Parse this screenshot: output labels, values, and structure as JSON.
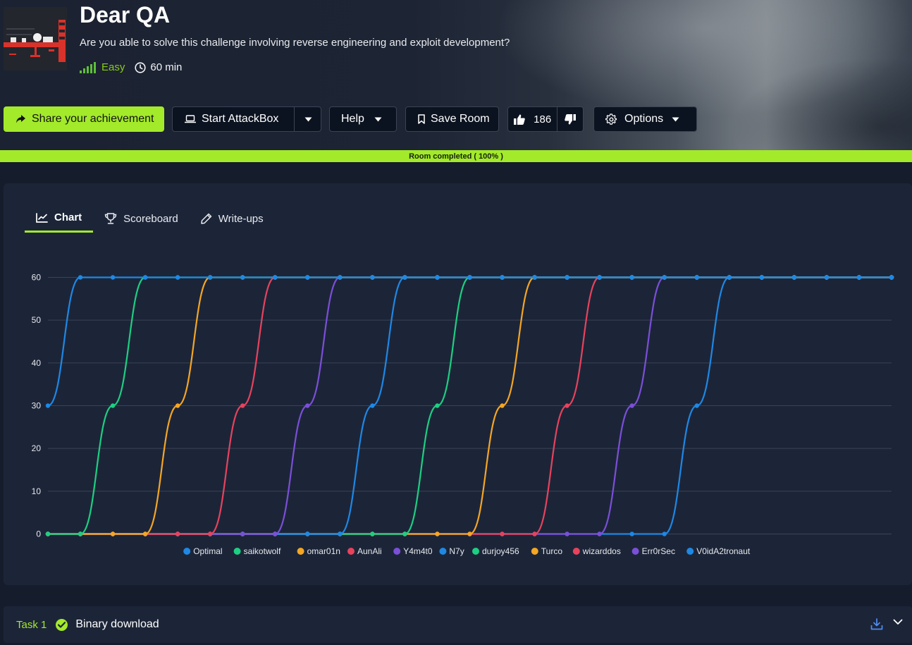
{
  "room": {
    "title": "Dear QA",
    "description": "Are you able to solve this challenge involving reverse engineering and exploit development?",
    "difficulty": "Easy",
    "duration": "60 min",
    "icon": "room-thumbnail"
  },
  "actions": {
    "share_label": "Share your achievement",
    "attackbox_label": "Start AttackBox",
    "help_label": "Help",
    "save_label": "Save Room",
    "upvotes": "186",
    "options_label": "Options"
  },
  "progress": {
    "label": "Room completed ( 100% )",
    "value": 1.0
  },
  "tabs": [
    {
      "label": "Chart",
      "active": true,
      "icon": "chart-line-icon"
    },
    {
      "label": "Scoreboard",
      "active": false,
      "icon": "trophy-icon"
    },
    {
      "label": "Write-ups",
      "active": false,
      "icon": "pencil-icon"
    }
  ],
  "chart_data": {
    "type": "line",
    "x": [
      0,
      1,
      2,
      3,
      4,
      5,
      6,
      7,
      8,
      9,
      10,
      11,
      12,
      13,
      14,
      15,
      16,
      17,
      18,
      19,
      20,
      21,
      22,
      23,
      24,
      25,
      26
    ],
    "yticks": [
      0,
      10,
      20,
      30,
      40,
      50,
      60
    ],
    "ylim": [
      0,
      60
    ],
    "grid": true,
    "legend": "bottom",
    "series": [
      {
        "name": "Optimal",
        "color": "#1e88e5",
        "values": [
          30,
          60,
          60,
          60,
          60,
          60,
          60,
          60,
          60,
          60,
          60,
          60,
          60,
          60,
          60,
          60,
          60,
          60,
          60,
          60,
          60,
          60,
          60,
          60,
          60,
          60,
          60
        ]
      },
      {
        "name": "saikotwolf",
        "color": "#1dcf82",
        "values": [
          0,
          0,
          30,
          60,
          60,
          60,
          60,
          60,
          60,
          60,
          60,
          60,
          60,
          60,
          60,
          60,
          60,
          60,
          60,
          60,
          60,
          60,
          60,
          60,
          60,
          60,
          60
        ]
      },
      {
        "name": "omar01n",
        "color": "#f5a623",
        "values": [
          0,
          0,
          0,
          0,
          30,
          60,
          60,
          60,
          60,
          60,
          60,
          60,
          60,
          60,
          60,
          60,
          60,
          60,
          60,
          60,
          60,
          60,
          60,
          60,
          60,
          60,
          60
        ]
      },
      {
        "name": "AunAli",
        "color": "#e8425d",
        "values": [
          0,
          0,
          0,
          0,
          0,
          0,
          30,
          60,
          60,
          60,
          60,
          60,
          60,
          60,
          60,
          60,
          60,
          60,
          60,
          60,
          60,
          60,
          60,
          60,
          60,
          60,
          60
        ]
      },
      {
        "name": "Y4m4t0",
        "color": "#7b4fd8",
        "values": [
          0,
          0,
          0,
          0,
          0,
          0,
          0,
          0,
          30,
          60,
          60,
          60,
          60,
          60,
          60,
          60,
          60,
          60,
          60,
          60,
          60,
          60,
          60,
          60,
          60,
          60,
          60
        ]
      },
      {
        "name": "N7y",
        "color": "#1e88e5",
        "values": [
          0,
          0,
          0,
          0,
          0,
          0,
          0,
          0,
          0,
          0,
          30,
          60,
          60,
          60,
          60,
          60,
          60,
          60,
          60,
          60,
          60,
          60,
          60,
          60,
          60,
          60,
          60
        ]
      },
      {
        "name": "durjoy456",
        "color": "#1dcf82",
        "values": [
          0,
          0,
          0,
          0,
          0,
          0,
          0,
          0,
          0,
          0,
          0,
          0,
          30,
          60,
          60,
          60,
          60,
          60,
          60,
          60,
          60,
          60,
          60,
          60,
          60,
          60,
          60
        ]
      },
      {
        "name": "Turco",
        "color": "#f5a623",
        "values": [
          0,
          0,
          0,
          0,
          0,
          0,
          0,
          0,
          0,
          0,
          0,
          0,
          0,
          0,
          30,
          60,
          60,
          60,
          60,
          60,
          60,
          60,
          60,
          60,
          60,
          60,
          60
        ]
      },
      {
        "name": "wizarddos",
        "color": "#e8425d",
        "values": [
          0,
          0,
          0,
          0,
          0,
          0,
          0,
          0,
          0,
          0,
          0,
          0,
          0,
          0,
          0,
          0,
          30,
          60,
          60,
          60,
          60,
          60,
          60,
          60,
          60,
          60,
          60
        ]
      },
      {
        "name": "Err0rSec",
        "color": "#7b4fd8",
        "values": [
          0,
          0,
          0,
          0,
          0,
          0,
          0,
          0,
          0,
          0,
          0,
          0,
          0,
          0,
          0,
          0,
          0,
          0,
          30,
          60,
          60,
          60,
          60,
          60,
          60,
          60,
          60
        ]
      },
      {
        "name": "V0idA2tronaut",
        "color": "#1e88e5",
        "values": [
          0,
          0,
          0,
          0,
          0,
          0,
          0,
          0,
          0,
          0,
          0,
          0,
          0,
          0,
          0,
          0,
          0,
          0,
          0,
          0,
          30,
          60,
          60,
          60,
          60,
          60,
          60
        ]
      }
    ]
  },
  "task": {
    "number": "Task 1",
    "title": "Binary download",
    "completed": true
  }
}
